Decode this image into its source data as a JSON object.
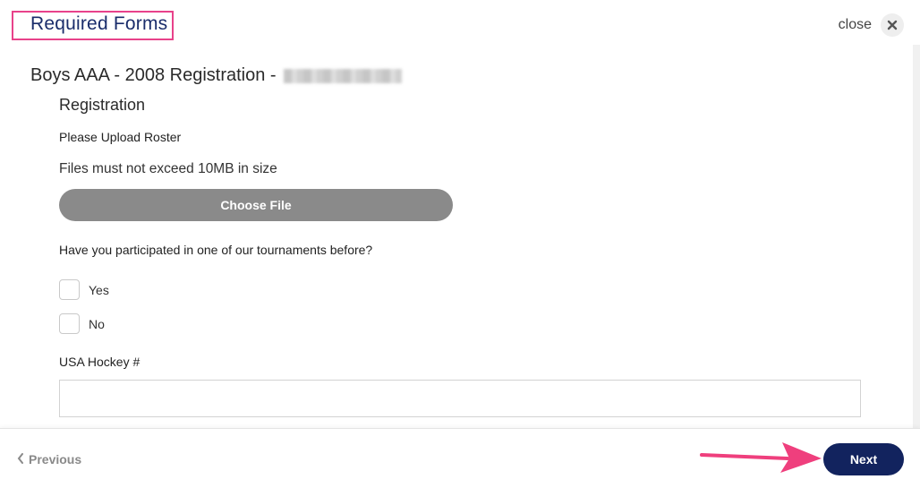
{
  "header": {
    "title": "Required Forms",
    "close_label": "close"
  },
  "form": {
    "section_title": "Boys AAA - 2008 Registration - ",
    "subheading": "Registration",
    "upload_label": "Please Upload Roster",
    "size_note": "Files must not exceed 10MB in size",
    "choose_file_label": "Choose File",
    "question": "Have you participated in one of our tournaments before?",
    "options": [
      {
        "label": "Yes",
        "checked": false
      },
      {
        "label": "No",
        "checked": false
      }
    ],
    "hockey_label": "USA Hockey #",
    "hockey_value": ""
  },
  "footer": {
    "previous_label": "Previous",
    "next_label": "Next"
  },
  "colors": {
    "highlight": "#e8428a",
    "title": "#1a2d6b",
    "next_button": "#12235e",
    "choose_file_button": "#8a8a8a",
    "arrow": "#ef3f7d"
  },
  "icons": [
    "close-icon",
    "chevron-left-icon",
    "arrow-annotation"
  ]
}
